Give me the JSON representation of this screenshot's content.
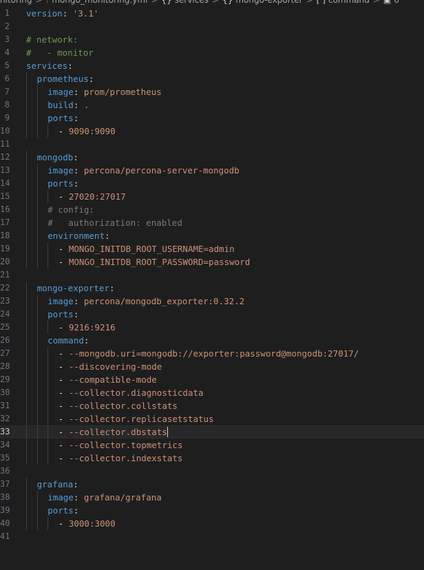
{
  "breadcrumb": {
    "items": [
      {
        "label": "nitoring",
        "icon": ""
      },
      {
        "label": "mongo_monitoring.yml",
        "icon": "yaml-file-icon"
      },
      {
        "label": "services",
        "icon": "braces-icon"
      },
      {
        "label": "mongo-exporter",
        "icon": "braces-icon"
      },
      {
        "label": "command",
        "icon": "brackets-icon"
      },
      {
        "label": "6",
        "icon": "box-icon"
      }
    ],
    "separator": ">"
  },
  "editor": {
    "current_line": 33,
    "lines": [
      {
        "n": "1",
        "indent": 0,
        "parts": [
          [
            "k",
            "version"
          ],
          [
            "p",
            ": "
          ],
          [
            "s",
            "'3.1'"
          ]
        ]
      },
      {
        "n": "2",
        "indent": 0,
        "parts": []
      },
      {
        "n": "3",
        "indent": 0,
        "parts": [
          [
            "c",
            "# network:"
          ]
        ]
      },
      {
        "n": "4",
        "indent": 0,
        "parts": [
          [
            "c",
            "#   - monitor"
          ]
        ]
      },
      {
        "n": "5",
        "indent": 0,
        "parts": [
          [
            "k",
            "services"
          ],
          [
            "p",
            ":"
          ]
        ]
      },
      {
        "n": "6",
        "indent": 1,
        "parts": [
          [
            "k",
            "prometheus"
          ],
          [
            "p",
            ":"
          ]
        ]
      },
      {
        "n": "7",
        "indent": 2,
        "parts": [
          [
            "k",
            "image"
          ],
          [
            "p",
            ": "
          ],
          [
            "v",
            "prom/prometheus"
          ]
        ]
      },
      {
        "n": "8",
        "indent": 2,
        "parts": [
          [
            "k",
            "build"
          ],
          [
            "p",
            ": "
          ],
          [
            "v",
            "."
          ]
        ]
      },
      {
        "n": "9",
        "indent": 2,
        "parts": [
          [
            "k",
            "ports"
          ],
          [
            "p",
            ":"
          ]
        ]
      },
      {
        "n": "10",
        "indent": 3,
        "parts": [
          [
            "p",
            "- "
          ],
          [
            "v",
            "9090:9090"
          ]
        ]
      },
      {
        "n": "11",
        "indent": 0,
        "parts": []
      },
      {
        "n": "12",
        "indent": 1,
        "parts": [
          [
            "k",
            "mongodb"
          ],
          [
            "p",
            ":"
          ]
        ]
      },
      {
        "n": "13",
        "indent": 2,
        "parts": [
          [
            "k",
            "image"
          ],
          [
            "p",
            ": "
          ],
          [
            "v",
            "percona/percona-server-mongodb"
          ]
        ]
      },
      {
        "n": "14",
        "indent": 2,
        "parts": [
          [
            "k",
            "ports"
          ],
          [
            "p",
            ":"
          ]
        ]
      },
      {
        "n": "15",
        "indent": 3,
        "parts": [
          [
            "p",
            "- "
          ],
          [
            "v",
            "27020:27017"
          ]
        ]
      },
      {
        "n": "16",
        "indent": 2,
        "parts": [
          [
            "cg",
            "# config:"
          ]
        ]
      },
      {
        "n": "17",
        "indent": 2,
        "parts": [
          [
            "cg",
            "#   authorization: enabled"
          ]
        ]
      },
      {
        "n": "18",
        "indent": 2,
        "parts": [
          [
            "k",
            "environment"
          ],
          [
            "p",
            ":"
          ]
        ]
      },
      {
        "n": "19",
        "indent": 3,
        "parts": [
          [
            "p",
            "- "
          ],
          [
            "v",
            "MONGO_INITDB_ROOT_USERNAME=admin"
          ]
        ]
      },
      {
        "n": "20",
        "indent": 3,
        "parts": [
          [
            "p",
            "- "
          ],
          [
            "v",
            "MONGO_INITDB_ROOT_PASSWORD=password"
          ]
        ]
      },
      {
        "n": "21",
        "indent": 0,
        "parts": []
      },
      {
        "n": "22",
        "indent": 1,
        "parts": [
          [
            "k",
            "mongo-exporter"
          ],
          [
            "p",
            ":"
          ]
        ]
      },
      {
        "n": "23",
        "indent": 2,
        "parts": [
          [
            "k",
            "image"
          ],
          [
            "p",
            ": "
          ],
          [
            "v",
            "percona/mongodb_exporter:0.32.2"
          ]
        ]
      },
      {
        "n": "24",
        "indent": 2,
        "parts": [
          [
            "k",
            "ports"
          ],
          [
            "p",
            ":"
          ]
        ]
      },
      {
        "n": "25",
        "indent": 3,
        "parts": [
          [
            "p",
            "- "
          ],
          [
            "v",
            "9216:9216"
          ]
        ]
      },
      {
        "n": "26",
        "indent": 2,
        "parts": [
          [
            "k",
            "command"
          ],
          [
            "p",
            ":"
          ]
        ]
      },
      {
        "n": "27",
        "indent": 3,
        "parts": [
          [
            "p",
            "- "
          ],
          [
            "v",
            "--mongodb.uri=mongodb://exporter:password@mongodb:27017/"
          ]
        ]
      },
      {
        "n": "28",
        "indent": 3,
        "parts": [
          [
            "p",
            "- "
          ],
          [
            "v",
            "--discovering-mode"
          ]
        ]
      },
      {
        "n": "29",
        "indent": 3,
        "parts": [
          [
            "p",
            "- "
          ],
          [
            "v",
            "--compatible-mode"
          ]
        ]
      },
      {
        "n": "30",
        "indent": 3,
        "parts": [
          [
            "p",
            "- "
          ],
          [
            "v",
            "--collector.diagnosticdata"
          ]
        ]
      },
      {
        "n": "31",
        "indent": 3,
        "parts": [
          [
            "p",
            "- "
          ],
          [
            "v",
            "--collector.collstats"
          ]
        ]
      },
      {
        "n": "32",
        "indent": 3,
        "parts": [
          [
            "p",
            "- "
          ],
          [
            "v",
            "--collector.replicasetstatus"
          ]
        ]
      },
      {
        "n": "33",
        "indent": 3,
        "parts": [
          [
            "p",
            "- "
          ],
          [
            "v",
            "--collector.dbstats"
          ]
        ]
      },
      {
        "n": "34",
        "indent": 3,
        "parts": [
          [
            "p",
            "- "
          ],
          [
            "v",
            "--collector.topmetrics"
          ]
        ]
      },
      {
        "n": "35",
        "indent": 3,
        "parts": [
          [
            "p",
            "- "
          ],
          [
            "v",
            "--collector.indexstats"
          ]
        ]
      },
      {
        "n": "36",
        "indent": 0,
        "parts": []
      },
      {
        "n": "37",
        "indent": 1,
        "parts": [
          [
            "k",
            "grafana"
          ],
          [
            "p",
            ":"
          ]
        ]
      },
      {
        "n": "38",
        "indent": 2,
        "parts": [
          [
            "k",
            "image"
          ],
          [
            "p",
            ": "
          ],
          [
            "v",
            "grafana/grafana"
          ]
        ]
      },
      {
        "n": "39",
        "indent": 2,
        "parts": [
          [
            "k",
            "ports"
          ],
          [
            "p",
            ":"
          ]
        ]
      },
      {
        "n": "40",
        "indent": 3,
        "parts": [
          [
            "p",
            "- "
          ],
          [
            "v",
            "3000:3000"
          ]
        ]
      },
      {
        "n": "41",
        "indent": 0,
        "parts": []
      }
    ]
  },
  "colors": {
    "background": "#1e1e1e",
    "key": "#569cd6",
    "string": "#ce9178",
    "comment": "#6a9955"
  }
}
